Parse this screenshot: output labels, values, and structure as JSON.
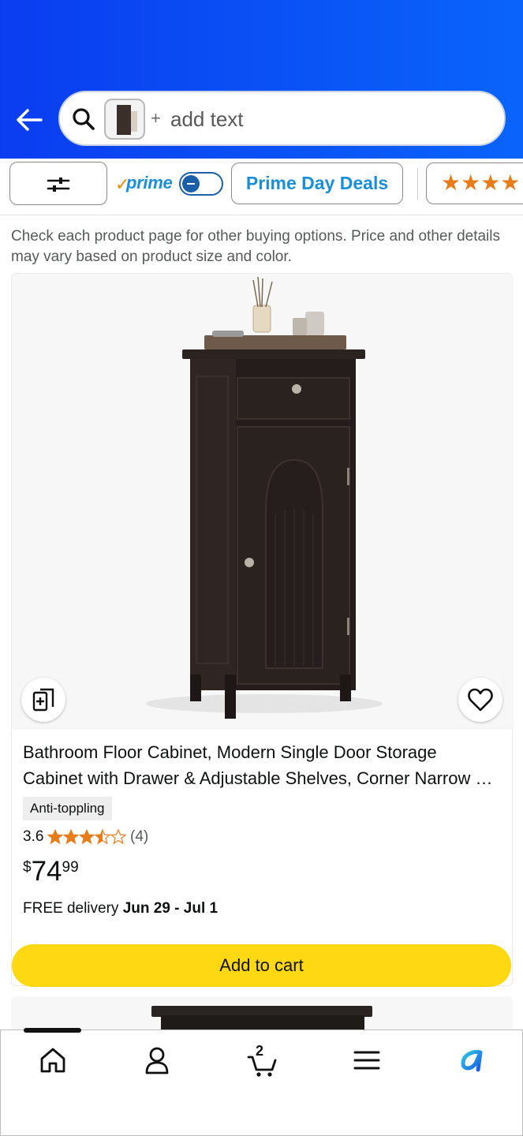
{
  "search": {
    "placeholder": "add text",
    "plus": "+"
  },
  "filters": {
    "prime_check": "✓",
    "prime_label": "prime",
    "deals_label": "Prime Day Deals",
    "stars_label": "★★★★"
  },
  "disclaimer": "Check each product page for other buying options. Price and other details may vary based on product size and color.",
  "product": {
    "title_line1": "Bathroom Floor Cabinet, Modern Single Door Storage",
    "title_line2": "Cabinet with Drawer & Adjustable Shelves, Corner Narrow Floor Storage Cabinet",
    "badge": "Anti-toppling",
    "rating": "3.6",
    "rating_value": 3.6,
    "review_count": "(4)",
    "price_symbol": "$",
    "price_whole": "74",
    "price_fraction": "99",
    "delivery_prefix": "FREE delivery ",
    "delivery_date": "Jun 29 - Jul 1",
    "add_to_cart": "Add to cart"
  },
  "bottom_nav": {
    "cart_count": "2",
    "items": [
      "home-icon",
      "account-icon",
      "cart-icon",
      "menu-icon",
      "rufus-icon"
    ]
  },
  "colors": {
    "header_blue": "#0a52f5",
    "cart_yellow": "#ffd814",
    "star_orange": "#e77c1b",
    "prime_blue": "#1a8fd6"
  }
}
